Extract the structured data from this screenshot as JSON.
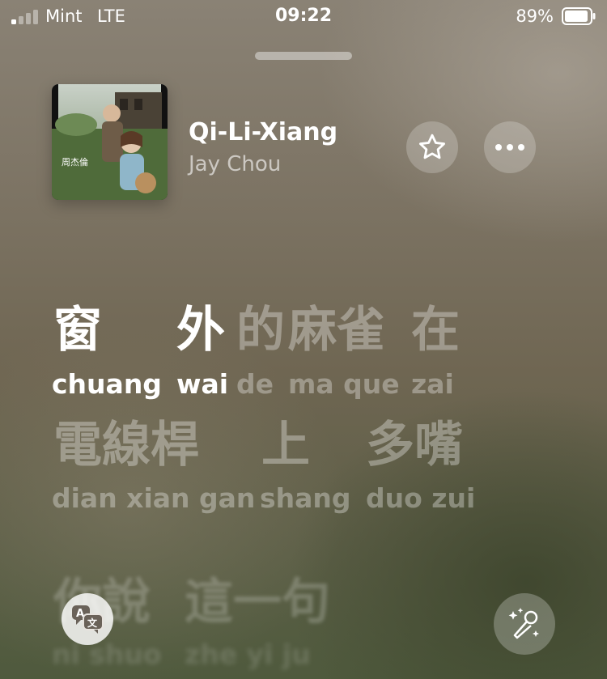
{
  "status_bar": {
    "carrier": "Mint",
    "network": "LTE",
    "time": "09:22",
    "battery_percent": "89%",
    "battery_level": 0.89,
    "signal_bars_active": 1,
    "signal_bars_total": 4
  },
  "now_playing": {
    "title": "Qi-Li-Xiang",
    "artist": "Jay Chou",
    "favorite_icon": "star-icon",
    "more_icon": "ellipsis-icon"
  },
  "lyrics": [
    {
      "state": "current",
      "words": [
        {
          "hanzi": "窗",
          "pinyin": "chuang",
          "sung": true
        },
        {
          "hanzi": "外",
          "pinyin": "wai",
          "sung": true
        },
        {
          "hanzi": "的",
          "pinyin": "de",
          "sung": false
        },
        {
          "hanzi": "麻雀",
          "pinyin": "ma que",
          "sung": false
        },
        {
          "hanzi": "在",
          "pinyin": "zai",
          "sung": false
        }
      ]
    },
    {
      "state": "upcoming",
      "words": [
        {
          "hanzi": "電線桿",
          "pinyin": "dian xian gan"
        },
        {
          "hanzi": "上",
          "pinyin": "shang"
        },
        {
          "hanzi": "多嘴",
          "pinyin": "duo zui"
        }
      ]
    },
    {
      "state": "faded",
      "words": [
        {
          "hanzi": "你說",
          "pinyin": "ni shuo"
        },
        {
          "hanzi": "這一句",
          "pinyin": "zhe yi ju"
        }
      ]
    }
  ],
  "controls": {
    "translate_icon": "translate-icon",
    "karaoke_icon": "microphone-sparkle-icon"
  },
  "colors": {
    "accent_text": "#ffffff",
    "dim_text": "rgba(255,255,255,0.33)"
  }
}
